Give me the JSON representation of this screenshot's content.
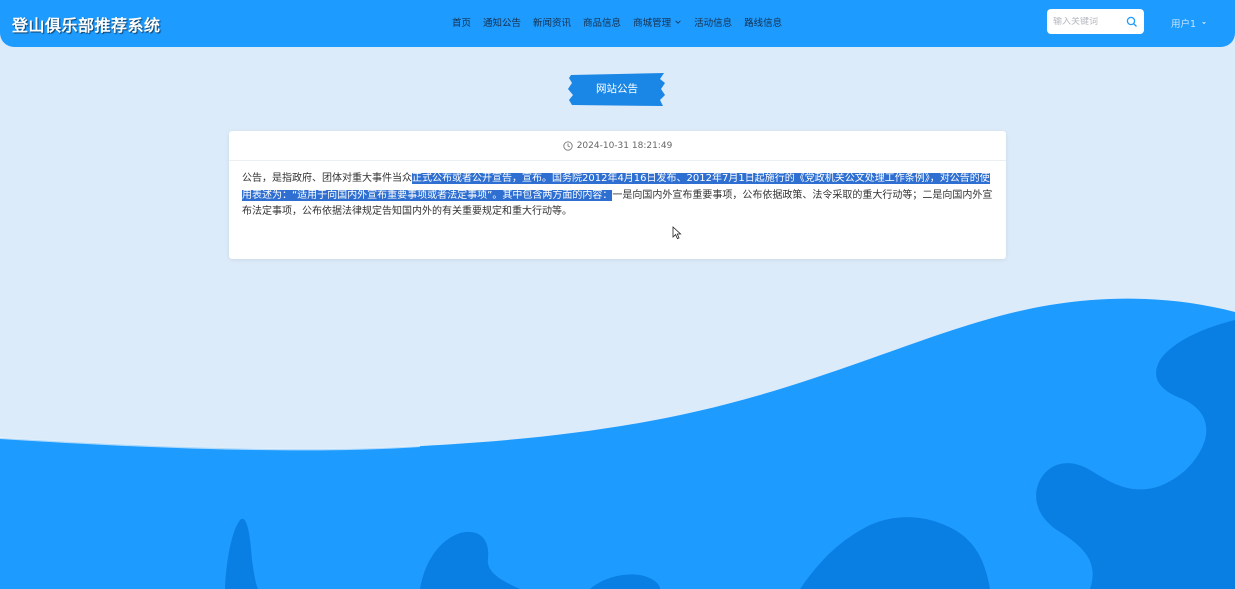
{
  "header": {
    "site_title": "登山俱乐部推荐系统",
    "nav": [
      {
        "label": "首页"
      },
      {
        "label": "通知公告"
      },
      {
        "label": "新闻资讯"
      },
      {
        "label": "商品信息"
      },
      {
        "label": "商城管理",
        "has_dropdown": true
      },
      {
        "label": "活动信息"
      },
      {
        "label": "路线信息"
      }
    ],
    "search": {
      "placeholder": "输入关键词",
      "value": ""
    },
    "user_label": "用户1"
  },
  "page_badge": "网站公告",
  "notice": {
    "timestamp": "2024-10-31 18:21:49",
    "text_before": "公告，是指政府、团体对重大事件当众",
    "text_highlighted": "正式公布或者公开宣告，宣布。国务院2012年4月16日发布、2012年7月1日起施行的《党政机关公文处理工作条例》，对公告的使用表述为：“适用于向国内外宣布重要事项或者法定事项”。其中包含两方面的内容：",
    "text_after": "一是向国内外宣布重要事项，公布依据政策、法令采取的重大行动等；二是向国内外宣布法定事项，公布依据法律规定告知国内外的有关重要规定和重大行动等。"
  },
  "colors": {
    "header_bg": "#1e9bff",
    "page_bg": "#dcebf9",
    "badge_bg": "#1a86e6",
    "selection": "#2e6fd1",
    "wave_light": "#1e9bff",
    "wave_dark": "#0a7fe3"
  },
  "icons": {
    "search": "search-icon",
    "clock": "clock-icon",
    "dropdown": "chevron-down-icon"
  }
}
